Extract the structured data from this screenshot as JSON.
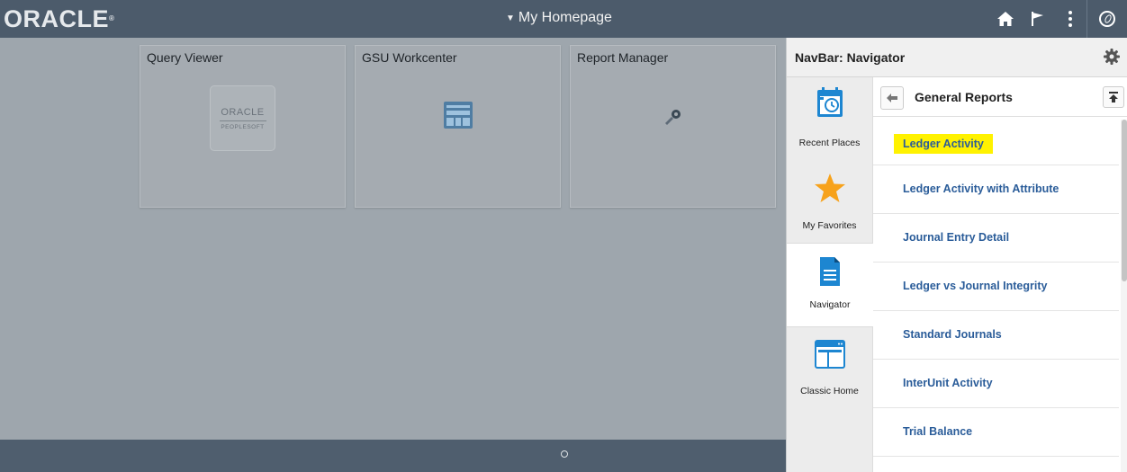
{
  "header": {
    "logo": "ORACLE",
    "logo_mark": "®",
    "page_title": "My Homepage"
  },
  "tiles": [
    {
      "title": "Query Viewer",
      "icon": "oracle-peoplesoft-logo",
      "logo_text": "ORACLE",
      "logo_sub": "PEOPLESOFT"
    },
    {
      "title": "GSU Workcenter",
      "icon": "workcenter-window-icon"
    },
    {
      "title": "Report Manager",
      "icon": "wrench-gear-icon"
    }
  ],
  "navbar": {
    "title": "NavBar: Navigator",
    "side_items": [
      {
        "label": "Recent Places",
        "icon": "calendar-clock-icon"
      },
      {
        "label": "My Favorites",
        "icon": "star-icon"
      },
      {
        "label": "Navigator",
        "icon": "document-icon"
      },
      {
        "label": "Classic Home",
        "icon": "window-icon"
      }
    ],
    "folder_title": "General Reports",
    "items": [
      "Ledger Activity",
      "Ledger Activity with Attribute",
      "Journal Entry Detail",
      "Ledger vs Journal Integrity",
      "Standard Journals",
      "InterUnit Activity",
      "Trial Balance"
    ]
  },
  "colors": {
    "topbar": "#4c5b6b",
    "link": "#2a5c99",
    "highlight": "#fff200",
    "accent_blue": "#1d86d1",
    "star": "#f7a21b"
  }
}
